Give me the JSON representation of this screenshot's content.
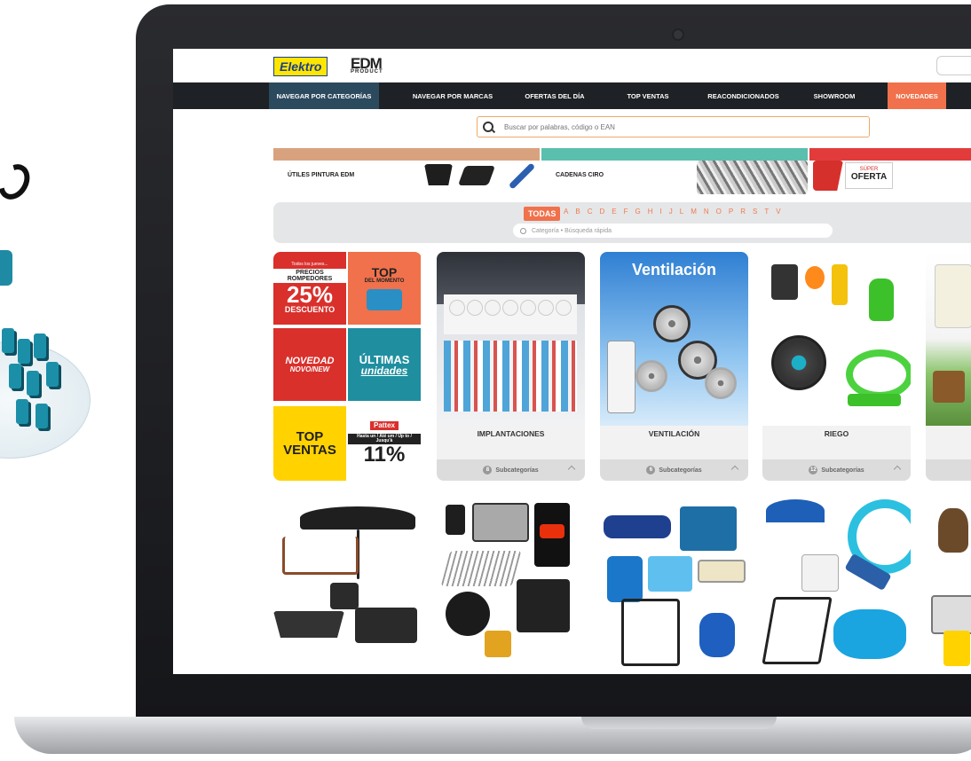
{
  "header": {
    "logo_elektro": "Elektro",
    "logo_edm": "EDM",
    "logo_edm_sub": "PRODUCT"
  },
  "nav": {
    "items": [
      {
        "label": "NAVEGAR POR CATEGORÍAS"
      },
      {
        "label": "NAVEGAR POR MARCAS"
      },
      {
        "label": "OFERTAS DEL DÍA"
      },
      {
        "label": "TOP VENTAS"
      },
      {
        "label": "REACONDICIONADOS"
      },
      {
        "label": "SHOWROOM"
      },
      {
        "label": "NOVEDADES"
      }
    ],
    "active_color": "#2c4a5e",
    "highlight_color": "#f0714b"
  },
  "search": {
    "placeholder": "Buscar por palabras, código o EAN"
  },
  "banners": [
    {
      "label": "ÚTILES PINTURA EDM",
      "color": "#d9a27f"
    },
    {
      "label": "CADENAS CIRO",
      "color": "#5bbfae"
    },
    {
      "label_top": "SÚPER",
      "label_main": "OFERTA",
      "color": "#e23b3b"
    }
  ],
  "alphabet": {
    "all_label": "TODAS",
    "letters": [
      "A",
      "B",
      "C",
      "D",
      "E",
      "F",
      "G",
      "H",
      "I",
      "J",
      "L",
      "M",
      "N",
      "O",
      "P",
      "R",
      "S",
      "T",
      "V"
    ],
    "quick_search_placeholder": "Categoría • Búsqueda rápida"
  },
  "promo": {
    "t1_small": "Todos los jueves...",
    "t1_top": "PRECIOS ROMPEDORES",
    "t1_big": "25%",
    "t1_bottom": "DESCUENTO",
    "t2_top": "TOP",
    "t2_sub": "DEL MOMENTO",
    "t3": "NOVEDAD",
    "t3_sub": "NOVO/NEW",
    "t4_top": "ÚLTIMAS",
    "t4_bottom": "unidades",
    "t5": "TOP VENTAS",
    "t6_brand": "Pattex",
    "t6_text": "Hasta un / Até um / Up to / Jusqu'à",
    "t6_big": "11%"
  },
  "categories": [
    {
      "title": "IMPLANTACIONES",
      "count": "8",
      "sub_label": "Subcategorías"
    },
    {
      "title": "VENTILACIÓN",
      "count": "6",
      "sub_label": "Subcategorías",
      "img_title": "Ventilación"
    },
    {
      "title": "RIEGO",
      "count": "12",
      "sub_label": "Subcategorías"
    }
  ]
}
